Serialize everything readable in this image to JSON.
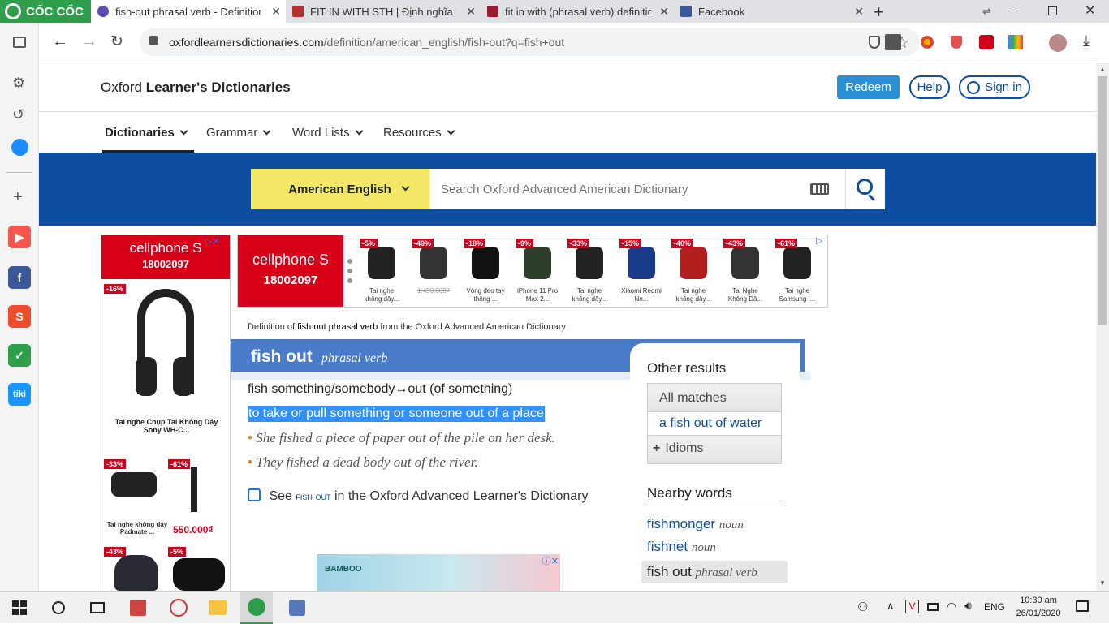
{
  "browser": {
    "brand": "CỐC CỐC",
    "tabs": [
      {
        "title": "fish-out phrasal verb - Definition, p",
        "active": true,
        "color": "#5b4db5"
      },
      {
        "title": "FIT IN WITH STH | Định nghĩa tron",
        "active": false,
        "color": "#b5312f"
      },
      {
        "title": "fit in with (phrasal verb) definition",
        "active": false,
        "color": "#9b1c2e"
      },
      {
        "title": "Facebook",
        "active": false,
        "color": "#3b5998"
      }
    ],
    "new_tab": "+",
    "url_domain": "oxfordlearnersdictionaries.com",
    "url_path": "/definition/american_english/fish-out?q=fish+out"
  },
  "site": {
    "logo_plain": "Oxford ",
    "logo_bold": "Learner's Dictionaries",
    "redeem": "Redeem",
    "help": "Help",
    "sign_in": "Sign in",
    "nav": [
      "Dictionaries",
      "Grammar",
      "Word Lists",
      "Resources"
    ],
    "dict_select": "American English",
    "search_placeholder": "Search Oxford Advanced American Dictionary"
  },
  "ads": {
    "brand": "cellphone S",
    "phone": "18002097",
    "side_product": "Tai nghe Chụp Tai Không Dây Sony WH-C...",
    "side_discount": "-16%",
    "side_items": [
      {
        "disc": "-33%",
        "name": "Tai nghe không dây Padmate ...",
        "price": ""
      },
      {
        "disc": "-61%",
        "name": "",
        "price": "550.000₫"
      },
      {
        "disc": "-43%",
        "name": "",
        "price": ""
      },
      {
        "disc": "-5%",
        "name": "",
        "price": ""
      }
    ],
    "top_items": [
      {
        "disc": "-5%",
        "name": "Tai nghe không dây..."
      },
      {
        "disc": "-49%",
        "name": "1.490.000₫"
      },
      {
        "disc": "-18%",
        "name": "Vòng đeo tay thông ..."
      },
      {
        "disc": "-9%",
        "name": "iPhone 11 Pro Max 2..."
      },
      {
        "disc": "-33%",
        "name": "Tai nghe không dây..."
      },
      {
        "disc": "-15%",
        "name": "Xiaomi Redmi No..."
      },
      {
        "disc": "-40%",
        "name": "Tai nghe không dây..."
      },
      {
        "disc": "-43%",
        "name": "Tai Nghe Không Dâ..."
      },
      {
        "disc": "-61%",
        "name": "Tai nghe Samsung I..."
      }
    ],
    "bottom_brand": "BAMBOO"
  },
  "entry": {
    "source_pre": "Definition of ",
    "source_word": "fish out phrasal verb",
    "source_post": " from the Oxford Advanced American Dictionary",
    "headword": "fish out",
    "pos": "phrasal verb",
    "pattern": "fish something/somebody↔out (of something)",
    "definition": "to take or pull something or someone out of a place",
    "examples": [
      "She fished a piece of paper out of the pile on her desk.",
      "They fished a dead body out of the river."
    ],
    "see_pre": "See ",
    "see_link": "fish out",
    "see_post": " in the Oxford Advanced Learner's Dictionary"
  },
  "other_results": {
    "title": "Other results",
    "all_matches": "All matches",
    "match_link": "a fish out of water",
    "idioms": "Idioms"
  },
  "nearby": {
    "title": "Nearby words",
    "words": [
      {
        "word": "fishmonger",
        "pos": "noun"
      },
      {
        "word": "fishnet",
        "pos": "noun"
      },
      {
        "word": "fish out",
        "pos": "phrasal verb"
      }
    ]
  },
  "taskbar": {
    "lang": "ENG",
    "time": "10:30 am",
    "date": "26/01/2020"
  }
}
